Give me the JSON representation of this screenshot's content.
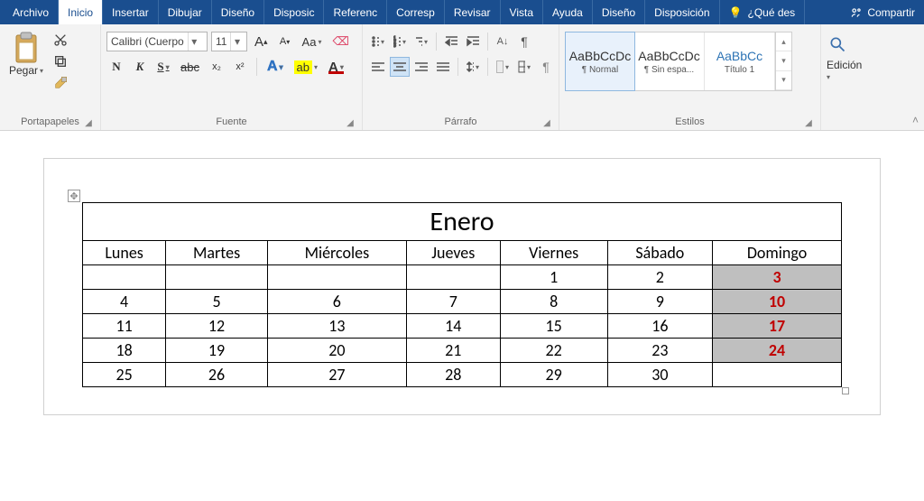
{
  "menubar": {
    "tabs": [
      "Archivo",
      "Inicio",
      "Insertar",
      "Dibujar",
      "Diseño",
      "Disposic",
      "Referenc",
      "Corresp",
      "Revisar",
      "Vista",
      "Ayuda",
      "Diseño",
      "Disposición"
    ],
    "active_index": 1,
    "tell_me": "¿Qué des",
    "share": "Compartir"
  },
  "ribbon": {
    "clipboard": {
      "paste": "Pegar",
      "group_label": "Portapapeles"
    },
    "font": {
      "name": "Calibri (Cuerpo",
      "size": "11",
      "grow": "A",
      "shrink": "A",
      "case": "Aa",
      "bold": "N",
      "italic": "K",
      "underline": "S",
      "strike": "abc",
      "sub": "x₂",
      "sup": "x²",
      "group_label": "Fuente"
    },
    "paragraph": {
      "group_label": "Párrafo"
    },
    "styles": {
      "items": [
        {
          "preview": "AaBbCcDc",
          "name": "¶ Normal"
        },
        {
          "preview": "AaBbCcDc",
          "name": "¶ Sin espa..."
        },
        {
          "preview": "AaBbCc",
          "name": "Título 1"
        }
      ],
      "group_label": "Estilos"
    },
    "editing": {
      "label": "Edición"
    }
  },
  "calendar": {
    "title": "Enero",
    "headers": [
      "Lunes",
      "Martes",
      "Miércoles",
      "Jueves",
      "Viernes",
      "Sábado",
      "Domingo"
    ],
    "rows": [
      [
        {
          "v": ""
        },
        {
          "v": ""
        },
        {
          "v": ""
        },
        {
          "v": ""
        },
        {
          "v": "1"
        },
        {
          "v": "2"
        },
        {
          "v": "3",
          "dom": true
        }
      ],
      [
        {
          "v": "4"
        },
        {
          "v": "5"
        },
        {
          "v": "6"
        },
        {
          "v": "7"
        },
        {
          "v": "8"
        },
        {
          "v": "9"
        },
        {
          "v": "10",
          "dom": true
        }
      ],
      [
        {
          "v": "11"
        },
        {
          "v": "12"
        },
        {
          "v": "13"
        },
        {
          "v": "14"
        },
        {
          "v": "15"
        },
        {
          "v": "16"
        },
        {
          "v": "17",
          "dom": true
        }
      ],
      [
        {
          "v": "18"
        },
        {
          "v": "19"
        },
        {
          "v": "20"
        },
        {
          "v": "21"
        },
        {
          "v": "22"
        },
        {
          "v": "23"
        },
        {
          "v": "24",
          "dom": true
        }
      ],
      [
        {
          "v": "25"
        },
        {
          "v": "26"
        },
        {
          "v": "27"
        },
        {
          "v": "28"
        },
        {
          "v": "29"
        },
        {
          "v": "30"
        },
        {
          "v": ""
        }
      ]
    ]
  }
}
